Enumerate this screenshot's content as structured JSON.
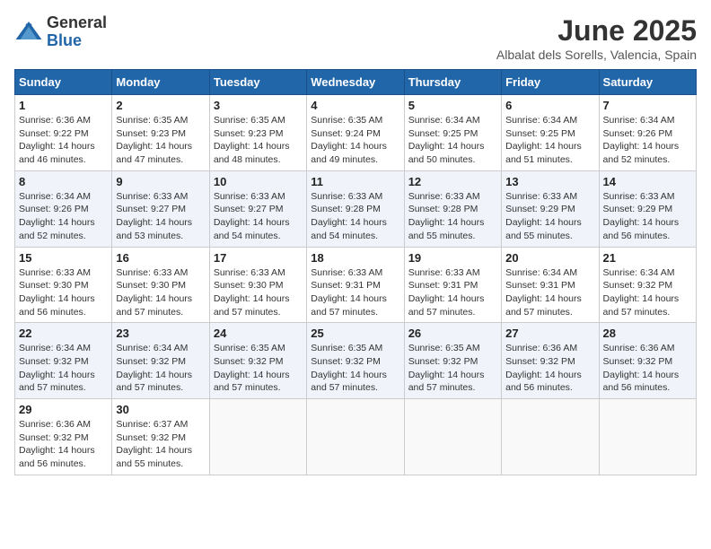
{
  "logo": {
    "general": "General",
    "blue": "Blue"
  },
  "title": "June 2025",
  "location": "Albalat dels Sorells, Valencia, Spain",
  "weekdays": [
    "Sunday",
    "Monday",
    "Tuesday",
    "Wednesday",
    "Thursday",
    "Friday",
    "Saturday"
  ],
  "weeks": [
    [
      {
        "day": "1",
        "sunrise": "6:36 AM",
        "sunset": "9:22 PM",
        "daylight": "14 hours and 46 minutes."
      },
      {
        "day": "2",
        "sunrise": "6:35 AM",
        "sunset": "9:23 PM",
        "daylight": "14 hours and 47 minutes."
      },
      {
        "day": "3",
        "sunrise": "6:35 AM",
        "sunset": "9:23 PM",
        "daylight": "14 hours and 48 minutes."
      },
      {
        "day": "4",
        "sunrise": "6:35 AM",
        "sunset": "9:24 PM",
        "daylight": "14 hours and 49 minutes."
      },
      {
        "day": "5",
        "sunrise": "6:34 AM",
        "sunset": "9:25 PM",
        "daylight": "14 hours and 50 minutes."
      },
      {
        "day": "6",
        "sunrise": "6:34 AM",
        "sunset": "9:25 PM",
        "daylight": "14 hours and 51 minutes."
      },
      {
        "day": "7",
        "sunrise": "6:34 AM",
        "sunset": "9:26 PM",
        "daylight": "14 hours and 52 minutes."
      }
    ],
    [
      {
        "day": "8",
        "sunrise": "6:34 AM",
        "sunset": "9:26 PM",
        "daylight": "14 hours and 52 minutes."
      },
      {
        "day": "9",
        "sunrise": "6:33 AM",
        "sunset": "9:27 PM",
        "daylight": "14 hours and 53 minutes."
      },
      {
        "day": "10",
        "sunrise": "6:33 AM",
        "sunset": "9:27 PM",
        "daylight": "14 hours and 54 minutes."
      },
      {
        "day": "11",
        "sunrise": "6:33 AM",
        "sunset": "9:28 PM",
        "daylight": "14 hours and 54 minutes."
      },
      {
        "day": "12",
        "sunrise": "6:33 AM",
        "sunset": "9:28 PM",
        "daylight": "14 hours and 55 minutes."
      },
      {
        "day": "13",
        "sunrise": "6:33 AM",
        "sunset": "9:29 PM",
        "daylight": "14 hours and 55 minutes."
      },
      {
        "day": "14",
        "sunrise": "6:33 AM",
        "sunset": "9:29 PM",
        "daylight": "14 hours and 56 minutes."
      }
    ],
    [
      {
        "day": "15",
        "sunrise": "6:33 AM",
        "sunset": "9:30 PM",
        "daylight": "14 hours and 56 minutes."
      },
      {
        "day": "16",
        "sunrise": "6:33 AM",
        "sunset": "9:30 PM",
        "daylight": "14 hours and 57 minutes."
      },
      {
        "day": "17",
        "sunrise": "6:33 AM",
        "sunset": "9:30 PM",
        "daylight": "14 hours and 57 minutes."
      },
      {
        "day": "18",
        "sunrise": "6:33 AM",
        "sunset": "9:31 PM",
        "daylight": "14 hours and 57 minutes."
      },
      {
        "day": "19",
        "sunrise": "6:33 AM",
        "sunset": "9:31 PM",
        "daylight": "14 hours and 57 minutes."
      },
      {
        "day": "20",
        "sunrise": "6:34 AM",
        "sunset": "9:31 PM",
        "daylight": "14 hours and 57 minutes."
      },
      {
        "day": "21",
        "sunrise": "6:34 AM",
        "sunset": "9:32 PM",
        "daylight": "14 hours and 57 minutes."
      }
    ],
    [
      {
        "day": "22",
        "sunrise": "6:34 AM",
        "sunset": "9:32 PM",
        "daylight": "14 hours and 57 minutes."
      },
      {
        "day": "23",
        "sunrise": "6:34 AM",
        "sunset": "9:32 PM",
        "daylight": "14 hours and 57 minutes."
      },
      {
        "day": "24",
        "sunrise": "6:35 AM",
        "sunset": "9:32 PM",
        "daylight": "14 hours and 57 minutes."
      },
      {
        "day": "25",
        "sunrise": "6:35 AM",
        "sunset": "9:32 PM",
        "daylight": "14 hours and 57 minutes."
      },
      {
        "day": "26",
        "sunrise": "6:35 AM",
        "sunset": "9:32 PM",
        "daylight": "14 hours and 57 minutes."
      },
      {
        "day": "27",
        "sunrise": "6:36 AM",
        "sunset": "9:32 PM",
        "daylight": "14 hours and 56 minutes."
      },
      {
        "day": "28",
        "sunrise": "6:36 AM",
        "sunset": "9:32 PM",
        "daylight": "14 hours and 56 minutes."
      }
    ],
    [
      {
        "day": "29",
        "sunrise": "6:36 AM",
        "sunset": "9:32 PM",
        "daylight": "14 hours and 56 minutes."
      },
      {
        "day": "30",
        "sunrise": "6:37 AM",
        "sunset": "9:32 PM",
        "daylight": "14 hours and 55 minutes."
      },
      null,
      null,
      null,
      null,
      null
    ]
  ]
}
